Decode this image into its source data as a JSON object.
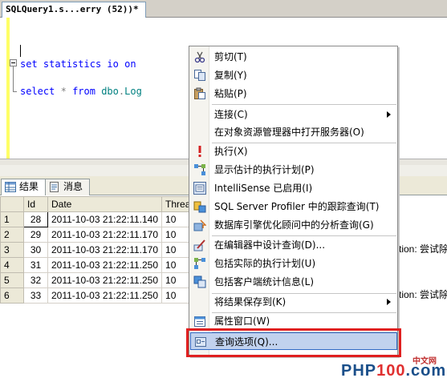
{
  "document_tab": {
    "title": "SQLQuery1.s...erry (52))*"
  },
  "editor": {
    "line1": {
      "kw1": "set",
      "kw2": "statistics",
      "kw3": "io",
      "kw4": "on"
    },
    "line2": {
      "kw1": "select",
      "star": "*",
      "kw2": "from",
      "schema": "dbo",
      "dot": ".",
      "table": "Log"
    }
  },
  "results": {
    "tabs": [
      {
        "label": "结果",
        "icon": "grid-icon",
        "active": true
      },
      {
        "label": "消息",
        "icon": "messages-icon",
        "active": false
      }
    ],
    "columns": [
      "",
      "Id",
      "Date",
      "Thread"
    ],
    "rows": [
      {
        "rn": "1",
        "id": "28",
        "date": "2011-10-03 21:22:11.140",
        "thread": "10"
      },
      {
        "rn": "2",
        "id": "29",
        "date": "2011-10-03 21:22:11.170",
        "thread": "10"
      },
      {
        "rn": "3",
        "id": "30",
        "date": "2011-10-03 21:22:11.170",
        "thread": "10"
      },
      {
        "rn": "4",
        "id": "31",
        "date": "2011-10-03 21:22:11.250",
        "thread": "10"
      },
      {
        "rn": "5",
        "id": "32",
        "date": "2011-10-03 21:22:11.250",
        "thread": "10"
      },
      {
        "rn": "6",
        "id": "33",
        "date": "2011-10-03 21:22:11.250",
        "thread": "10"
      }
    ],
    "message_fragments": {
      "row3": "tion: 尝试除以",
      "row6": "tion: 尝试除以"
    }
  },
  "context_menu": {
    "items": [
      {
        "label": "剪切(T)",
        "icon": "scissors-icon"
      },
      {
        "label": "复制(Y)",
        "icon": "copy-icon"
      },
      {
        "label": "粘贴(P)",
        "icon": "paste-icon"
      },
      {
        "label": "连接(C)",
        "icon": "",
        "submenu": true
      },
      {
        "label": "在对象资源管理器中打开服务器(O)",
        "icon": ""
      },
      {
        "label": "执行(X)",
        "icon": "execute-icon"
      },
      {
        "label": "显示估计的执行计划(P)",
        "icon": "estimated-plan-icon"
      },
      {
        "label": "IntelliSense 已启用(I)",
        "icon": "intellisense-icon"
      },
      {
        "label": "SQL Server Profiler 中的跟踪查询(T)",
        "icon": "profiler-icon"
      },
      {
        "label": "数据库引擎优化顾问中的分析查询(G)",
        "icon": "tuning-advisor-icon"
      },
      {
        "label": "在编辑器中设计查询(D)...",
        "icon": "design-query-icon"
      },
      {
        "label": "包括实际的执行计划(U)",
        "icon": "actual-plan-icon"
      },
      {
        "label": "包括客户端统计信息(L)",
        "icon": "client-stats-icon"
      },
      {
        "label": "将结果保存到(K)",
        "icon": "",
        "submenu": true
      },
      {
        "label": "属性窗口(W)",
        "icon": "properties-icon"
      },
      {
        "label": "查询选项(Q)...",
        "icon": "query-options-icon",
        "highlighted": true
      }
    ]
  },
  "watermark": {
    "php": "PHP",
    "num": "100",
    "com": ".com",
    "sub": "中文网"
  },
  "colors": {
    "keyword": "#0000ff",
    "object": "#008080",
    "highlight": "#c1d2ee",
    "callout": "#e02020"
  }
}
